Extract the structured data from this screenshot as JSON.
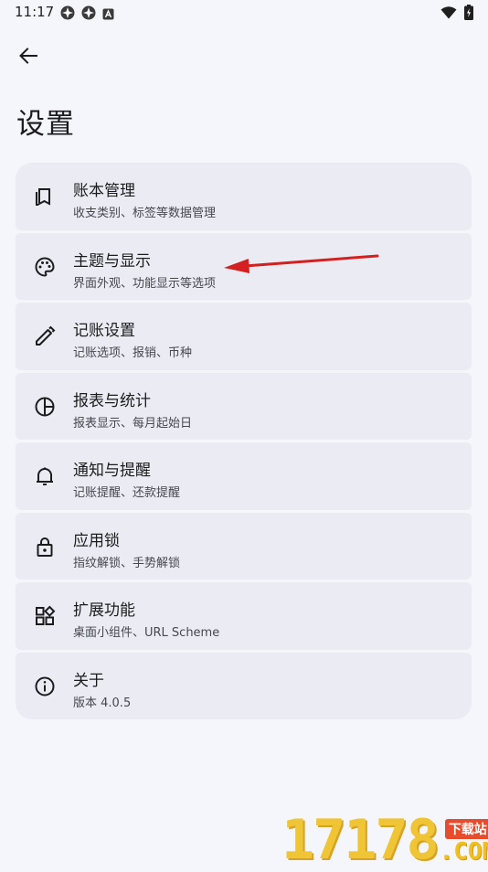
{
  "status_bar": {
    "time": "11:17",
    "left_icons": [
      "sync-icon",
      "sync-icon",
      "app-notification-icon"
    ],
    "right_icons": [
      "wifi-icon",
      "battery-charging-icon"
    ]
  },
  "header": {
    "title": "设置",
    "back_icon": "arrow-back-icon"
  },
  "settings": [
    {
      "icon": "book-icon",
      "title": "账本管理",
      "subtitle": "收支类别、标签等数据管理"
    },
    {
      "icon": "palette-icon",
      "title": "主题与显示",
      "subtitle": "界面外观、功能显示等选项"
    },
    {
      "icon": "pencil-icon",
      "title": "记账设置",
      "subtitle": "记账选项、报销、币种"
    },
    {
      "icon": "pie-chart-icon",
      "title": "报表与统计",
      "subtitle": "报表显示、每月起始日"
    },
    {
      "icon": "bell-icon",
      "title": "通知与提醒",
      "subtitle": "记账提醒、还款提醒"
    },
    {
      "icon": "lock-icon",
      "title": "应用锁",
      "subtitle": "指纹解锁、手势解锁"
    },
    {
      "icon": "widgets-icon",
      "title": "扩展功能",
      "subtitle": "桌面小组件、URL Scheme"
    },
    {
      "icon": "info-icon",
      "title": "关于",
      "subtitle": "版本 4.0.5"
    }
  ],
  "watermark": {
    "digits": "17178",
    "tag": "下载站",
    "domain": ".COM"
  },
  "colors": {
    "background": "#f5f6fb",
    "card": "#ebecf3",
    "annotation_arrow": "#d42020"
  }
}
